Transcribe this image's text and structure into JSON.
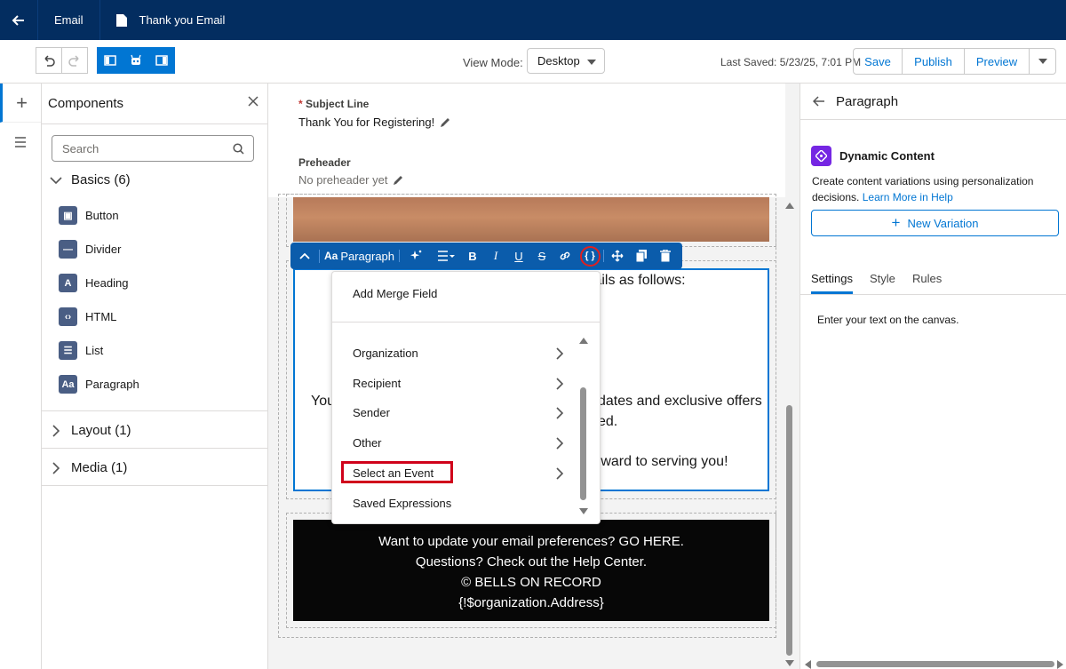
{
  "topbar": {
    "tab1": "Email",
    "tab2": "Thank you Email"
  },
  "toolbar": {
    "view_mode_label": "View Mode:",
    "view_mode_value": "Desktop",
    "last_saved": "Last Saved: 5/23/25, 7:01 PM",
    "save": "Save",
    "publish": "Publish",
    "preview": "Preview"
  },
  "components": {
    "title": "Components",
    "search_placeholder": "Search",
    "basics": "Basics (6)",
    "items": [
      "Button",
      "Divider",
      "Heading",
      "HTML",
      "List",
      "Paragraph"
    ],
    "layout": "Layout (1)",
    "media": "Media (1)"
  },
  "canvas": {
    "subject_label": "Subject Line",
    "subject_value": "Thank You for Registering!",
    "preheader_label": "Preheader",
    "preheader_value": "No preheader yet",
    "para_tool_label": "Paragraph",
    "para_line1": "tails as follows:",
    "para_line2a": "You",
    "para_line2b": "dates and exclusive offers",
    "para_line3": "ed.",
    "para_line4": "rward to serving you!",
    "footer": [
      "Want to update your email preferences? GO HERE.",
      "Questions? Check out the Help Center.",
      "© BELLS ON RECORD",
      "{!$organization.Address}"
    ]
  },
  "merge_menu": {
    "title": "Add Merge Field",
    "items": [
      "Organization",
      "Recipient",
      "Sender",
      "Other",
      "Select an Event",
      "Saved Expressions"
    ]
  },
  "right_panel": {
    "title": "Paragraph",
    "dyn_title": "Dynamic Content",
    "dyn_desc": "Create content variations using personalization decisions.",
    "dyn_link": "Learn More in Help",
    "new_variation": "New Variation",
    "tabs": [
      "Settings",
      "Style",
      "Rules"
    ],
    "body": "Enter your text on the canvas."
  }
}
